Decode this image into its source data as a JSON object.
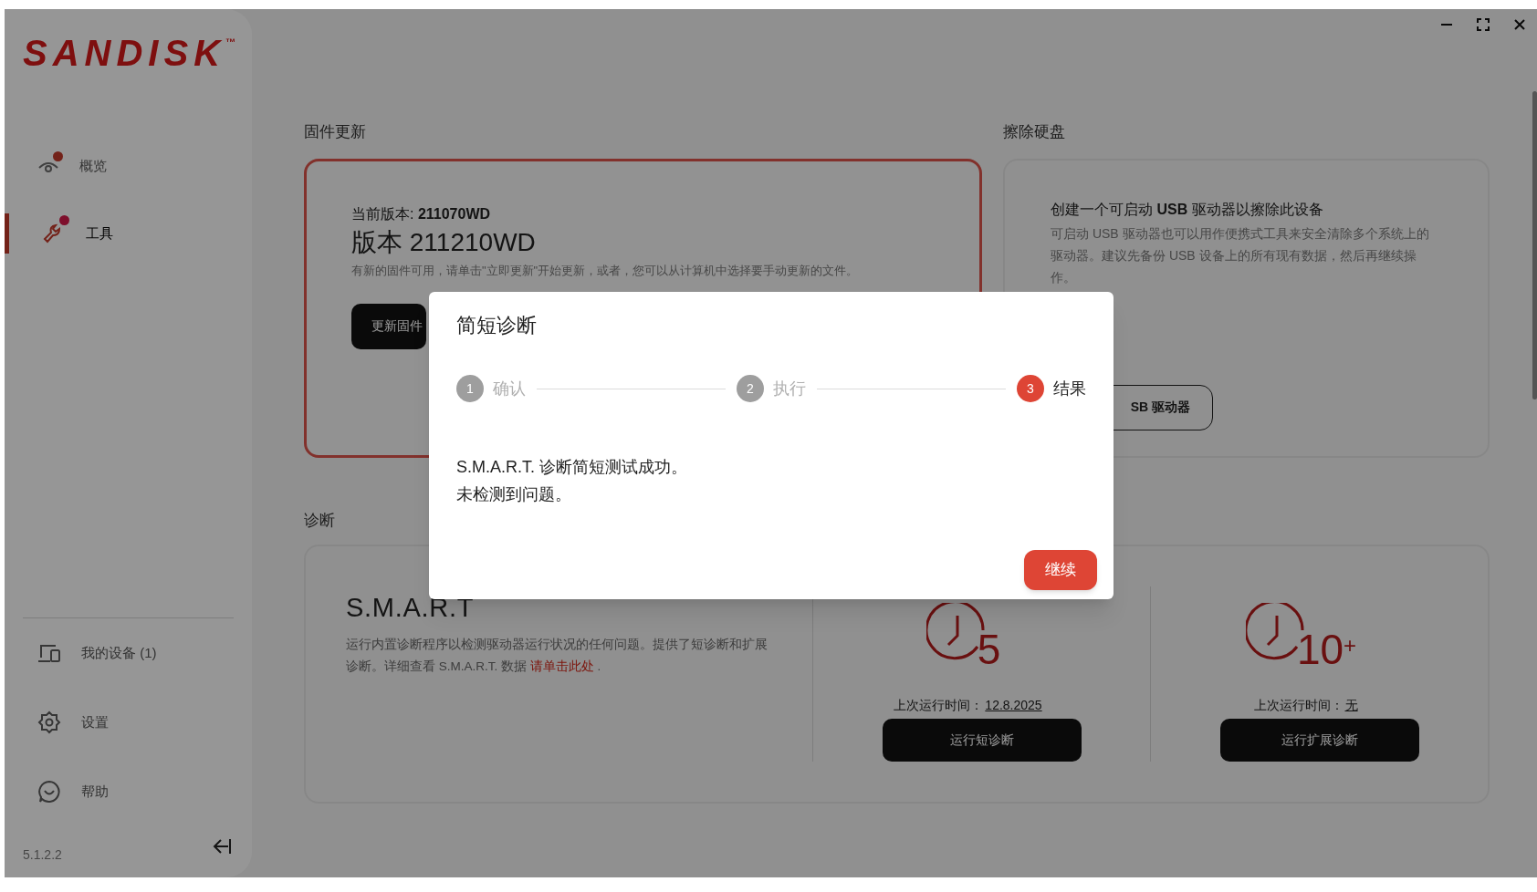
{
  "sidebar": {
    "logo": "SANDISK",
    "trademark": "™",
    "nav": [
      {
        "label": "概览",
        "selected": false,
        "notification": true
      },
      {
        "label": "工具",
        "selected": true,
        "notification": true
      }
    ],
    "bottom_items": [
      {
        "label": "我的设备 (1)"
      },
      {
        "label": "设置"
      },
      {
        "label": "帮助"
      }
    ],
    "version": "5.1.2.2"
  },
  "firmware": {
    "heading": "固件更新",
    "current_version": "当前版本: **211070WD**",
    "new_version": "版本 211210WD",
    "description": "有新的固件可用，请单击\"立即更新\"开始更新，或者，您可以从计算机中选择要手动更新的文件。",
    "button": "更新固件"
  },
  "erase": {
    "heading": "擦除硬盘",
    "title": "创建一个可启动 **USB** 驱动器以擦除此设备",
    "description": "可启动 USB 驱动器也可以用作便携式工具来安全清除多个系统上的驱动器。建议先备份 USB 设备上的所有现有数据，然后再继续操作。",
    "button": "SB 驱动器"
  },
  "diagnostics": {
    "heading": "诊断",
    "title": "S.M.A.R.T",
    "description": "运行内置诊断程序以检测驱动器运行状况的任何问题。提供了短诊断和扩展诊断。详细查看 S.M.A.R.T. 数据 ",
    "link": "请单击此处",
    "after_link": " .",
    "tests": [
      {
        "minutes": "5",
        "last_run_label": "上次运行时间：",
        "last_run": "12.8.2025",
        "button": "运行短诊断"
      },
      {
        "minutes": "10$^{+}$",
        "last_run_label": "上次运行时间：",
        "last_run": "无",
        "button": "运行扩展诊断"
      }
    ]
  },
  "dialog": {
    "title": "简短诊断",
    "steps": [
      {
        "number": "1",
        "label": "确认",
        "selected": false
      },
      {
        "number": "2",
        "label": "执行",
        "selected": false
      },
      {
        "number": "3",
        "label": "结果",
        "selected": true
      }
    ],
    "message": [
      "S.M.A.R.T. 诊断简短测试成功。",
      "未检测到问题。"
    ],
    "button": "继续"
  }
}
